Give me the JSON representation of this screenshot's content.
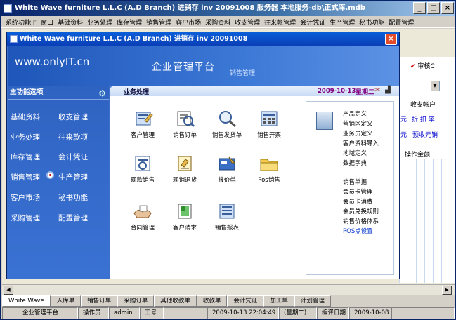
{
  "outer": {
    "title": "White Wave furniture L.L.C (A.D Branch) 进销存 inv 20091008 服务器 本地服务-db\\正式库.mdb",
    "menu": [
      "系统功能 F",
      "窗口",
      "基础资料",
      "业务处理",
      "库存管理",
      "销售管理",
      "客户市场",
      "采购资料",
      "收支管理",
      "往来帐管理",
      "会计凭证",
      "生产管理",
      "秘书功能",
      "配置管理"
    ],
    "min": "_",
    "max": "□",
    "close": "×"
  },
  "background": {
    "audit_label": "审核C",
    "account_label": "收支帐户",
    "discount_label": "折 扣 率",
    "yuan1": "元",
    "yuan2": "元",
    "receipt_label": "预收元销",
    "amount_label": "操作金额"
  },
  "dialog": {
    "title": "White Wave furniture L.L.C (A.D Branch) 进销存 inv 20091008",
    "close": "×",
    "logo": "www.onlyIT.cn",
    "platform_title": "企业管理平台",
    "platform_sub": "销售管理"
  },
  "nav": {
    "header": "主功能选项",
    "items": [
      {
        "left": "基础资料",
        "right": "收支管理"
      },
      {
        "left": "业务处理",
        "right": "往来款项"
      },
      {
        "left": "库存管理",
        "right": "会计凭证"
      },
      {
        "left": "销售管理",
        "right": "生产管理"
      },
      {
        "left": "客户市场",
        "right": "秘书功能"
      },
      {
        "left": "采购管理",
        "right": "配置管理"
      }
    ]
  },
  "content": {
    "section": "业务处理",
    "date": "2009-10-13",
    "weekday": "星期二",
    "tiles": [
      {
        "label": "客户管理",
        "icon": "customer-manage-icon"
      },
      {
        "label": "销售订单",
        "icon": "sales-order-icon"
      },
      {
        "label": "销售发货单",
        "icon": "delivery-note-icon"
      },
      {
        "label": "销售开票",
        "icon": "invoice-icon"
      },
      {
        "label": "现款销售",
        "icon": "cash-sale-icon"
      },
      {
        "label": "现销退货",
        "icon": "cash-return-icon"
      },
      {
        "label": "报价单",
        "icon": "quotation-icon"
      },
      {
        "label": "Pos销售",
        "icon": "pos-sale-icon"
      },
      {
        "label": "合同管理",
        "icon": "contract-icon"
      },
      {
        "label": "客户请求",
        "icon": "customer-request-icon"
      },
      {
        "label": "销售报表",
        "icon": "sales-report-icon"
      }
    ],
    "links": [
      "产品定义",
      "营销区定义",
      "业务员定义",
      "客户资料导入",
      "地域定义",
      "数据字典",
      "销售单据",
      "会员卡管理",
      "会员卡消费",
      "会员兑换规则",
      "销售价格体系",
      "POS点设置"
    ]
  },
  "bottom": {
    "tabs": [
      "White Wave",
      "入库单",
      "销售订单",
      "采购订单",
      "其他收款单",
      "收款单",
      "会计凭证",
      "加工单",
      "计划管理"
    ],
    "status": [
      "企业管理平台",
      "操作员",
      "admin",
      "工号",
      "",
      "2009-10-13 22:04:49",
      "(星期二)",
      "编译日期",
      "2009-10-08"
    ]
  }
}
